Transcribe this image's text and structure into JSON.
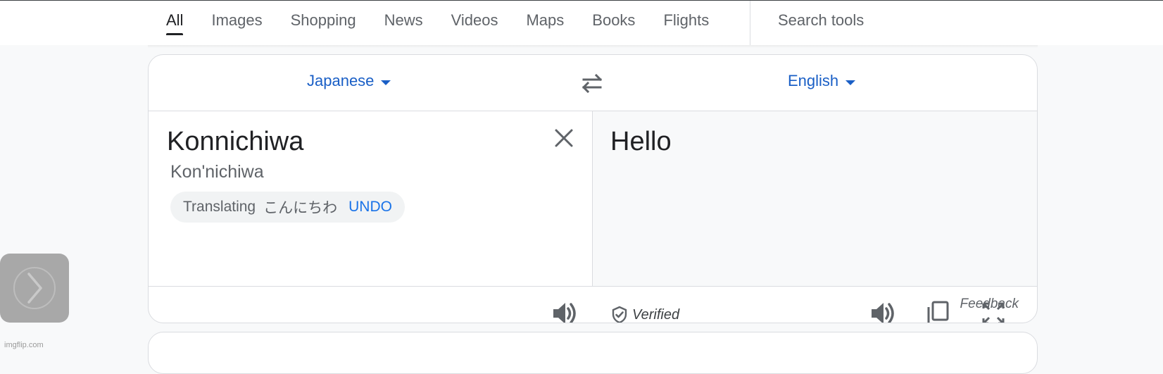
{
  "tabs": [
    {
      "label": "All",
      "active": true
    },
    {
      "label": "Images"
    },
    {
      "label": "Shopping"
    },
    {
      "label": "News"
    },
    {
      "label": "Videos"
    },
    {
      "label": "Maps"
    },
    {
      "label": "Books"
    },
    {
      "label": "Flights"
    }
  ],
  "search_tools_label": "Search tools",
  "translate": {
    "source_language": "Japanese",
    "target_language": "English",
    "source_text": "Konnichiwa",
    "romanization": "Kon'nichiwa",
    "chip": {
      "label": "Translating",
      "original": "こんにちわ",
      "undo_label": "UNDO"
    },
    "target_text": "Hello",
    "verified_label": "Verified",
    "feedback_label": "Feedback"
  },
  "watermark": "imgflip.com",
  "colors": {
    "accent_blue": "#1a5fc6",
    "link_blue": "#1a73e8",
    "icon_gray": "#5f6368"
  },
  "icons": [
    "swap-icon",
    "close-icon",
    "speaker-icon",
    "shield-check-icon",
    "copy-icon",
    "fullscreen-icon",
    "chevron-right-icon"
  ]
}
